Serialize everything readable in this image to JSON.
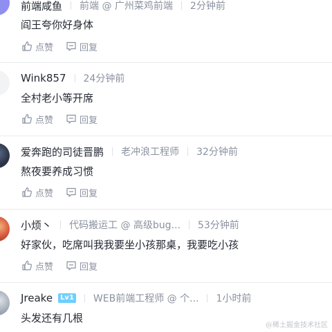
{
  "comments": [
    {
      "username": "前端咸鱼",
      "title": "前端 @ 广州菜鸡前端",
      "time": "2分钟前",
      "text": "阎王夸你好身体",
      "like_label": "点赞",
      "reply_label": "回复",
      "avatar_color": "#8e8ff0"
    },
    {
      "username": "Wink857",
      "time": "24分钟前",
      "text": "全村老小等开席",
      "like_label": "点赞",
      "reply_label": "回复",
      "avatar_color": "#f2f3f5"
    },
    {
      "username": "爱奔跑的司徒晋鹏",
      "title": "老冲浪工程师",
      "time": "32分钟前",
      "text": "熬夜要养成习惯",
      "like_label": "点赞",
      "reply_label": "回复",
      "avatar_color": "#2c3345"
    },
    {
      "username": "小烦丶",
      "title": "代码搬运工 @ 高级bug...",
      "time": "53分钟前",
      "text": "好家伙，吃席叫我我要坐小孩那桌，我要吃小孩",
      "like_label": "点赞",
      "reply_label": "回复",
      "avatar_color": "#d9573d"
    },
    {
      "username": "Jreake",
      "badge": "Lv1",
      "title": "WEB前端工程师 @ 个...",
      "time": "1小时前",
      "text": "头发还有几根",
      "avatar_color": "#9aa3b0"
    }
  ],
  "watermark": "@稀土掘金技术社区",
  "colors": {
    "text": "#252933",
    "muted": "#8a919f",
    "divider": "#e8eaed",
    "badge": "#6ecfff"
  }
}
